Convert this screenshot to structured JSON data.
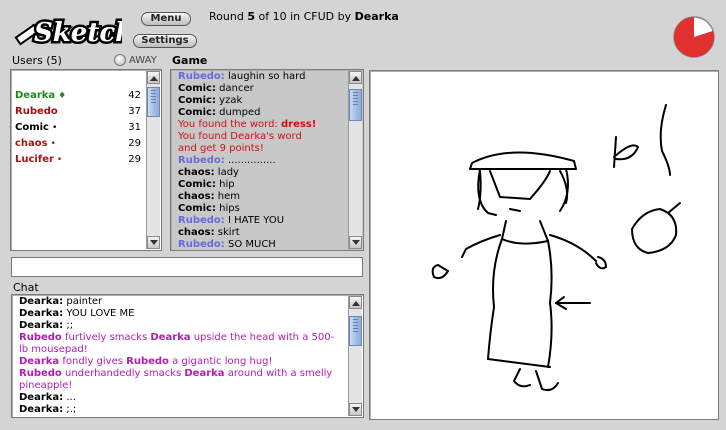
{
  "header": {
    "logo_text": "Sketch",
    "menu_label": "Menu",
    "settings_label": "Settings",
    "round_prefix": "Round",
    "round_current": "5",
    "round_of": "of",
    "round_total": "10",
    "round_in": "in",
    "room": "CFUD",
    "round_by": "by",
    "drawer": "Dearka",
    "timer_remaining_fraction": 0.8
  },
  "users": {
    "title": "Users (5)",
    "away_label": "AWAY",
    "list": [
      {
        "name": "Dearka",
        "marker": "♦",
        "score": "42",
        "color": "#1a8a1a"
      },
      {
        "name": "Rubedo",
        "marker": "",
        "score": "37",
        "color": "#a01010"
      },
      {
        "name": "Comic",
        "marker": "•",
        "score": "31",
        "color": "#000000"
      },
      {
        "name": "chaos",
        "marker": "•",
        "score": "29",
        "color": "#b01010"
      },
      {
        "name": "Lucifer",
        "marker": "•",
        "score": "29",
        "color": "#b01010"
      }
    ]
  },
  "game": {
    "title": "Game",
    "log": [
      {
        "who": "Rubedo:",
        "text": " laughin so hard",
        "who_color": "#6a6ad8",
        "text_color": "#000"
      },
      {
        "who": "Comic:",
        "text": " dancer",
        "who_color": "#000",
        "text_color": "#000"
      },
      {
        "who": "Comic:",
        "text": " yzak",
        "who_color": "#000",
        "text_color": "#000"
      },
      {
        "who": "Comic:",
        "text": " dumped",
        "who_color": "#000",
        "text_color": "#000"
      },
      {
        "who": "",
        "text": "You found the word: ",
        "strong": "dress!",
        "who_color": "#d01010",
        "text_color": "#d01010"
      },
      {
        "who": "",
        "text": "You found Dearka's word",
        "who_color": "#d01010",
        "text_color": "#d01010"
      },
      {
        "who": "",
        "text": "and get 9 points!",
        "who_color": "#d01010",
        "text_color": "#d01010"
      },
      {
        "who": "Rubedo:",
        "text": " ...............",
        "who_color": "#6a6ad8",
        "text_color": "#000"
      },
      {
        "who": "chaos:",
        "text": " lady",
        "who_color": "#000",
        "text_color": "#000"
      },
      {
        "who": "Comic:",
        "text": " hip",
        "who_color": "#000",
        "text_color": "#000"
      },
      {
        "who": "chaos:",
        "text": " hem",
        "who_color": "#000",
        "text_color": "#000"
      },
      {
        "who": "Comic:",
        "text": " hips",
        "who_color": "#000",
        "text_color": "#000"
      },
      {
        "who": "Rubedo:",
        "text": " I HATE YOU",
        "who_color": "#6a6ad8",
        "text_color": "#000"
      },
      {
        "who": "chaos:",
        "text": " skirt",
        "who_color": "#000",
        "text_color": "#000"
      },
      {
        "who": "Rubedo:",
        "text": " SO MUCH",
        "who_color": "#6a6ad8",
        "text_color": "#000"
      }
    ]
  },
  "chat_input": {
    "value": ""
  },
  "chat": {
    "title": "Chat",
    "lines": [
      {
        "parts": [
          {
            "t": "Dearka:",
            "b": true,
            "c": "#000"
          },
          {
            "t": " painter",
            "b": false,
            "c": "#000"
          }
        ]
      },
      {
        "parts": [
          {
            "t": "Dearka:",
            "b": true,
            "c": "#000"
          },
          {
            "t": " YOU LOVE ME",
            "b": false,
            "c": "#000"
          }
        ]
      },
      {
        "parts": [
          {
            "t": "Dearka:",
            "b": true,
            "c": "#000"
          },
          {
            "t": " ;;",
            "b": false,
            "c": "#000"
          }
        ]
      },
      {
        "parts": [
          {
            "t": "Rubedo",
            "b": true,
            "c": "#b41cb4"
          },
          {
            "t": " furtively smacks ",
            "b": false,
            "c": "#b41cb4"
          },
          {
            "t": "Dearka",
            "b": true,
            "c": "#b41cb4"
          },
          {
            "t": " upside the head with a 500-lb mousepad!",
            "b": false,
            "c": "#b41cb4"
          }
        ]
      },
      {
        "parts": [
          {
            "t": "Dearka",
            "b": true,
            "c": "#b41cb4"
          },
          {
            "t": " fondly gives ",
            "b": false,
            "c": "#b41cb4"
          },
          {
            "t": "Rubedo",
            "b": true,
            "c": "#b41cb4"
          },
          {
            "t": " a gigantic long hug!",
            "b": false,
            "c": "#b41cb4"
          }
        ]
      },
      {
        "parts": [
          {
            "t": "Rubedo",
            "b": true,
            "c": "#b41cb4"
          },
          {
            "t": " underhandedly smacks ",
            "b": false,
            "c": "#b41cb4"
          },
          {
            "t": "Dearka",
            "b": true,
            "c": "#b41cb4"
          },
          {
            "t": " around with a smelly pineapple!",
            "b": false,
            "c": "#b41cb4"
          }
        ]
      },
      {
        "parts": [
          {
            "t": "Dearka:",
            "b": true,
            "c": "#000"
          },
          {
            "t": " ...",
            "b": false,
            "c": "#000"
          }
        ]
      },
      {
        "parts": [
          {
            "t": "Dearka:",
            "b": true,
            "c": "#000"
          },
          {
            "t": " ;.;",
            "b": false,
            "c": "#000"
          }
        ]
      }
    ]
  }
}
